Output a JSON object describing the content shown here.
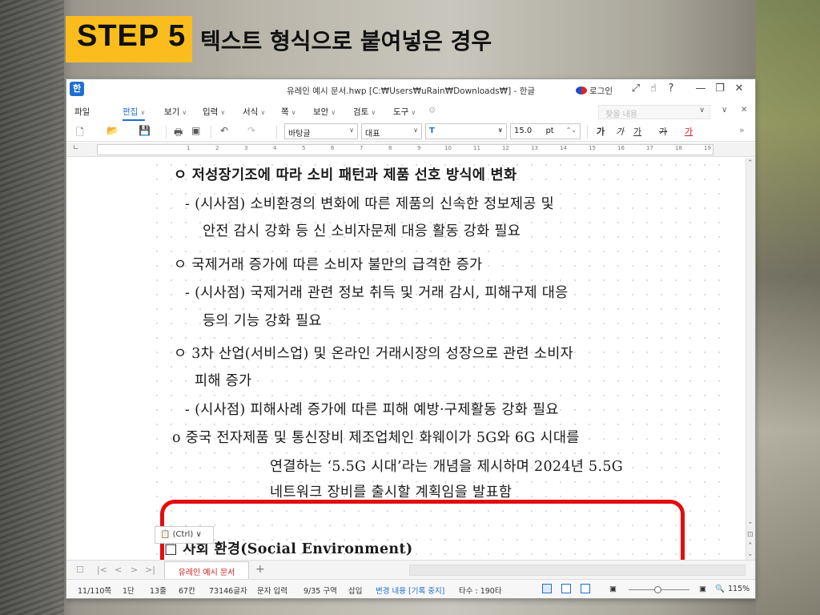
{
  "slide": {
    "step_label": "STEP 5",
    "heading": "텍스트 형식으로 붙여넣은 경우"
  },
  "window": {
    "app_logo": "한",
    "title": "유레인 예시 문서.hwp [C:₩Users₩uRain₩Downloads₩] - 한글",
    "login": "로그인",
    "icons": [
      "expand-icon",
      "hand-icon",
      "help-icon"
    ],
    "controls": {
      "minimize": "—",
      "restore": "❐",
      "close": "✕"
    }
  },
  "menubar": {
    "items": [
      "파일",
      "편집",
      "보기",
      "입력",
      "서식",
      "쪽",
      "보안",
      "검토",
      "도구"
    ],
    "active": "편집",
    "find_placeholder": "찾을 내용"
  },
  "toolbar": {
    "style": "바탕글",
    "font_group": "대표",
    "font_icon": "T",
    "size": "15.0",
    "size_unit": "pt",
    "format_buttons": [
      "가",
      "가",
      "가",
      "가",
      "가"
    ]
  },
  "ruler": {
    "numbers": [
      "1",
      "2",
      "3",
      "4",
      "5",
      "6",
      "7",
      "8",
      "9",
      "10",
      "11",
      "12",
      "13",
      "14",
      "15",
      "16",
      "17",
      "18",
      "19"
    ]
  },
  "document": {
    "lines": [
      "ㅇ 저성장기조에 따라 소비 패턴과 제품 선호 방식에 변화",
      "- (시사점) 소비환경의 변화에 따른 제품의 신속한 정보제공 및",
      "안전 감시 강화 등 신 소비자문제 대응 활동 강화 필요",
      "ㅇ 국제거래 증가에 따른 소비자 불만의 급격한 증가",
      "- (시사점) 국제거래 관련 정보 취득 및 거래 감시, 피해구제 대응",
      "등의 기능 강화 필요",
      "ㅇ 3차 산업(서비스업) 및 온라인 거래시장의 성장으로 관련 소비자",
      "피해 증가",
      "- (시사점) 피해사례 증가에 따른 피해 예방·구제활동 강화 필요",
      "o 중국 전자제품 및 통신장비 제조업체인 화웨이가 5G와 6G 시대를",
      "연결하는 ‘5.5G 시대’라는 개념을 제시하며 2024년 5.5G",
      "네트워크 장비를 출시할 계획임을 발표함",
      "□ 사회 환경(Social Environment)"
    ],
    "paste_option": "(Ctrl)",
    "highlight_color": "#e10e0e"
  },
  "tabbar": {
    "nav": [
      "|<",
      "<",
      ">",
      ">|"
    ],
    "doc_tab": "유레인 예시 문서",
    "add": "+"
  },
  "statusbar": {
    "page": "11/110쪽",
    "section": "1단",
    "line": "13줄",
    "col": "67칸",
    "chars": "73146글자",
    "mode": "문자 입력",
    "area": "9/35 구역",
    "insert": "삽입",
    "track": "변경 내용 [기록 중지]",
    "typing": "타수 : 190타",
    "zoom": "115%"
  }
}
